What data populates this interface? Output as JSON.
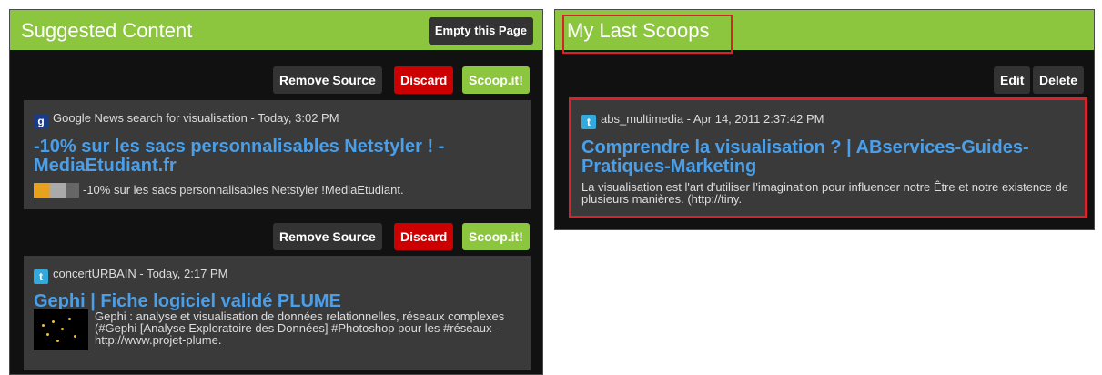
{
  "suggested": {
    "title": "Suggested Content",
    "empty_page_label": "Empty this Page",
    "items": [
      {
        "remove_source_label": "Remove Source",
        "discard_label": "Discard",
        "scoop_label": "Scoop.it!",
        "source_icon": "google-news-icon",
        "source": "Google News search for visualisation - Today, 3:02 PM",
        "title": "-10% sur les sacs personnalisables Netstyler ! - MediaEtudiant.fr",
        "excerpt": "-10% sur les sacs personnalisables Netstyler !MediaEtudiant."
      },
      {
        "remove_source_label": "Remove Source",
        "discard_label": "Discard",
        "scoop_label": "Scoop.it!",
        "source_icon": "twitter-icon",
        "source": "concertURBAIN - Today, 2:17 PM",
        "title": "Gephi | Fiche logiciel validé PLUME",
        "excerpt": "Gephi : analyse et visualisation de données relationnelles, réseaux complexes (#Gephi [Analyse Exploratoire des Données] #Photoshop pour les #réseaux - http://www.projet-plume."
      }
    ]
  },
  "last_scoops": {
    "title": "My Last Scoops",
    "edit_label": "Edit",
    "delete_label": "Delete",
    "items": [
      {
        "source_icon": "twitter-icon",
        "source": "abs_multimedia - Apr 14, 2011 2:37:42 PM",
        "title": "Comprendre la visualisation ? | ABservices-Guides-Pratiques-Marketing",
        "excerpt": "La visualisation est l'art d'utiliser l'imagination pour influencer notre Être et notre existence de plusieurs manières. (http://tiny."
      }
    ]
  },
  "colors": {
    "accent_green": "#8cc63f",
    "discard_red": "#cc0000",
    "link_blue": "#4a9fe8",
    "highlight_red": "#d9232a"
  }
}
